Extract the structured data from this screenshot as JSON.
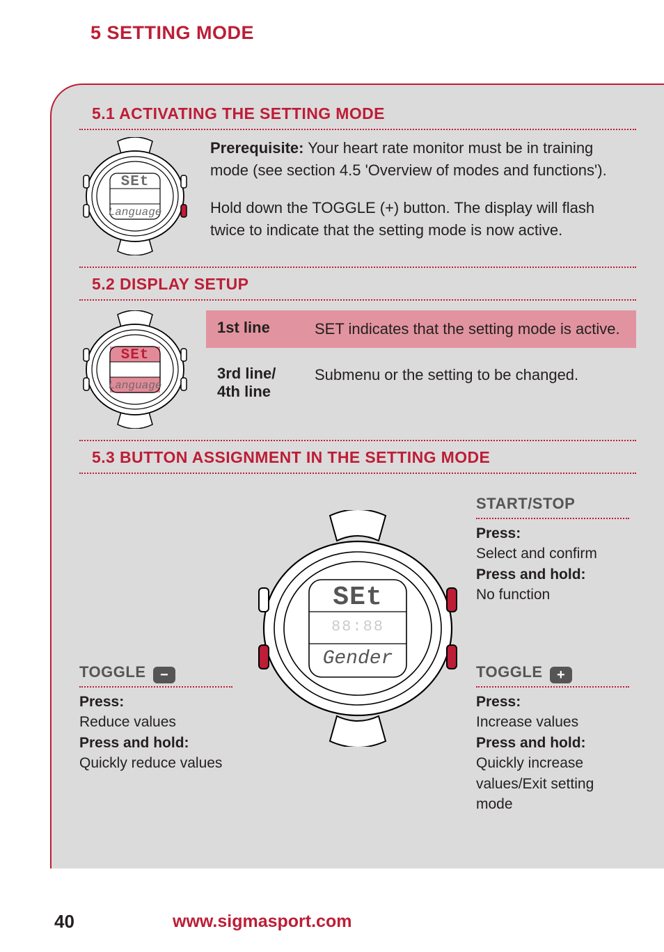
{
  "chapter": {
    "title": "5 SETTING MODE"
  },
  "section51": {
    "heading": "5.1 ACTIVATING THE SETTING MODE",
    "prereq_label": "Prerequisite:",
    "prereq_text": " Your heart rate monitor must be in training mode (see section 4.5 'Overview of modes and functions').",
    "body": "Hold down the TOGGLE (+) button. The display will flash twice to indicate that the setting mode is now active.",
    "watch": {
      "line1": "SEt",
      "line3": "Language"
    }
  },
  "section52": {
    "heading": "5.2 DISPLAY SETUP",
    "row1": {
      "label": "1st line",
      "text": "SET indicates that the setting mode is active."
    },
    "row2": {
      "label": "3rd line/ 4th line",
      "text": "Submenu or the setting to be changed."
    },
    "watch": {
      "line1": "SEt",
      "line3": "Language"
    }
  },
  "section53": {
    "heading": "5.3 BUTTON ASSIGNMENT IN THE SETTING MODE",
    "watch": {
      "line1": "SEt",
      "line3": "Gender"
    },
    "start_stop": {
      "title": "START/STOP",
      "press_label": "Press:",
      "press_text": "Select and confirm",
      "hold_label": "Press and hold:",
      "hold_text": "No function"
    },
    "toggle_plus": {
      "title": "TOGGLE",
      "symbol": "+",
      "press_label": "Press:",
      "press_text": "Increase values",
      "hold_label": "Press and hold:",
      "hold_text": "Quickly increase values/Exit setting mode"
    },
    "toggle_minus": {
      "title": "TOGGLE",
      "symbol": "−",
      "press_label": "Press:",
      "press_text": "Reduce values",
      "hold_label": "Press and hold:",
      "hold_text": "Quickly reduce values"
    }
  },
  "footer": {
    "page": "40",
    "url": "www.sigmasport.com"
  }
}
